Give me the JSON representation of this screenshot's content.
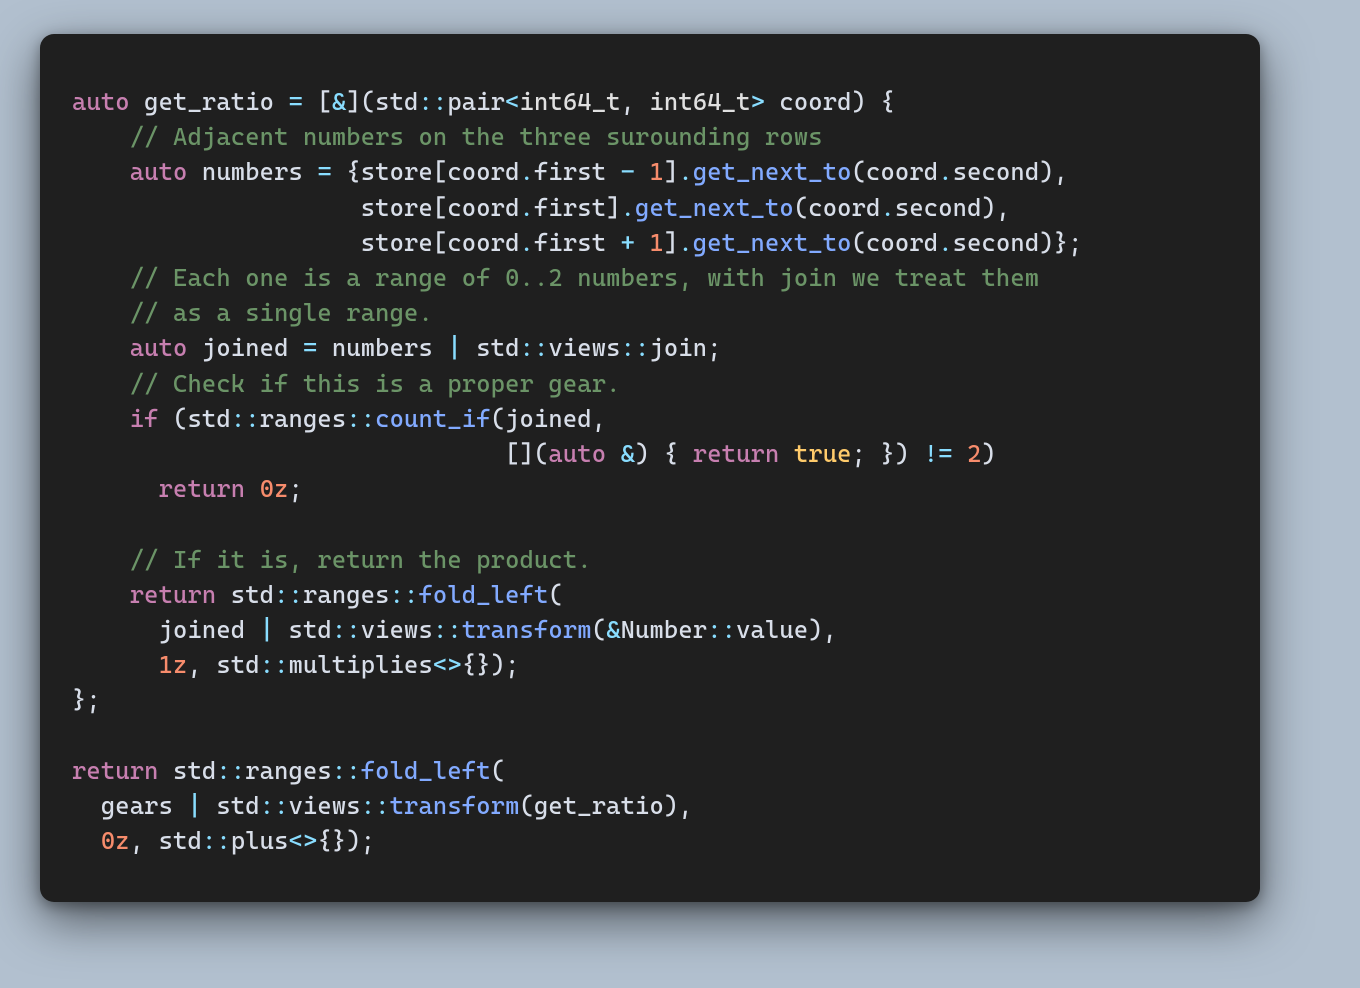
{
  "code": {
    "l1": {
      "a": "auto",
      "b": " get_ratio ",
      "c": "=",
      "d": " [",
      "e": "&",
      "f": "](std",
      "g": "::",
      "h": "pair",
      "i": "<",
      "j": "int64_t",
      "k": ",",
      "l": " ",
      "m": "int64_t",
      "n": ">",
      "o": " coord) {"
    },
    "l2": {
      "a": "    ",
      "b": "// Adjacent numbers on the three surounding rows"
    },
    "l3": {
      "a": "    ",
      "b": "auto",
      "c": " numbers ",
      "d": "=",
      "e": " {store[coord",
      "f": ".",
      "g": "first ",
      "h": "-",
      "i": " ",
      "j": "1",
      "k": "]",
      "l": ".",
      "m": "get_next_to",
      "n": "(coord",
      "o": ".",
      "p": "second),"
    },
    "l4": {
      "a": "                    store[coord",
      "b": ".",
      "c": "first]",
      "d": ".",
      "e": "get_next_to",
      "f": "(coord",
      "g": ".",
      "h": "second),"
    },
    "l5": {
      "a": "                    store[coord",
      "b": ".",
      "c": "first ",
      "d": "+",
      "e": " ",
      "f": "1",
      "g": "]",
      "h": ".",
      "i": "get_next_to",
      "j": "(coord",
      "k": ".",
      "l": "second)};"
    },
    "l6": {
      "a": "    ",
      "b": "// Each one is a range of 0..2 numbers, with join we treat them"
    },
    "l7": {
      "a": "    ",
      "b": "// as a single range."
    },
    "l8": {
      "a": "    ",
      "b": "auto",
      "c": " joined ",
      "d": "=",
      "e": " numbers ",
      "f": "|",
      "g": " std",
      "h": "::",
      "i": "views",
      "j": "::",
      "k": "join;"
    },
    "l9": {
      "a": "    ",
      "b": "// Check if this is a proper gear."
    },
    "l10": {
      "a": "    ",
      "b": "if",
      "c": " (std",
      "d": "::",
      "e": "ranges",
      "f": "::",
      "g": "count_if",
      "h": "(joined,"
    },
    "l11": {
      "a": "                              [](",
      "b": "auto",
      "c": " ",
      "d": "&",
      "e": ") { ",
      "f": "return",
      "g": " ",
      "h": "true",
      "i": "; }) ",
      "j": "!=",
      "k": " ",
      "l": "2",
      "m": ")"
    },
    "l12": {
      "a": "      ",
      "b": "return",
      "c": " ",
      "d": "0z",
      "e": ";"
    },
    "l13": {
      "a": ""
    },
    "l14": {
      "a": "    ",
      "b": "// If it is, return the product."
    },
    "l15": {
      "a": "    ",
      "b": "return",
      "c": " std",
      "d": "::",
      "e": "ranges",
      "f": "::",
      "g": "fold_left",
      "h": "("
    },
    "l16": {
      "a": "      joined ",
      "b": "|",
      "c": " std",
      "d": "::",
      "e": "views",
      "f": "::",
      "g": "transform",
      "h": "(",
      "i": "&",
      "j": "Number",
      "k": "::",
      "l": "value),"
    },
    "l17": {
      "a": "      ",
      "b": "1z",
      "c": ", std",
      "d": "::",
      "e": "multiplies",
      "f": "<>",
      "g": "{});"
    },
    "l18": {
      "a": "};"
    },
    "l19": {
      "a": ""
    },
    "l20": {
      "a": "return",
      "b": " std",
      "c": "::",
      "d": "ranges",
      "e": "::",
      "f": "fold_left",
      "g": "("
    },
    "l21": {
      "a": "  gears ",
      "b": "|",
      "c": " std",
      "d": "::",
      "e": "views",
      "f": "::",
      "g": "transform",
      "h": "(get_ratio),"
    },
    "l22": {
      "a": "  ",
      "b": "0z",
      "c": ", std",
      "d": "::",
      "e": "plus",
      "f": "<>",
      "g": "{});"
    }
  }
}
